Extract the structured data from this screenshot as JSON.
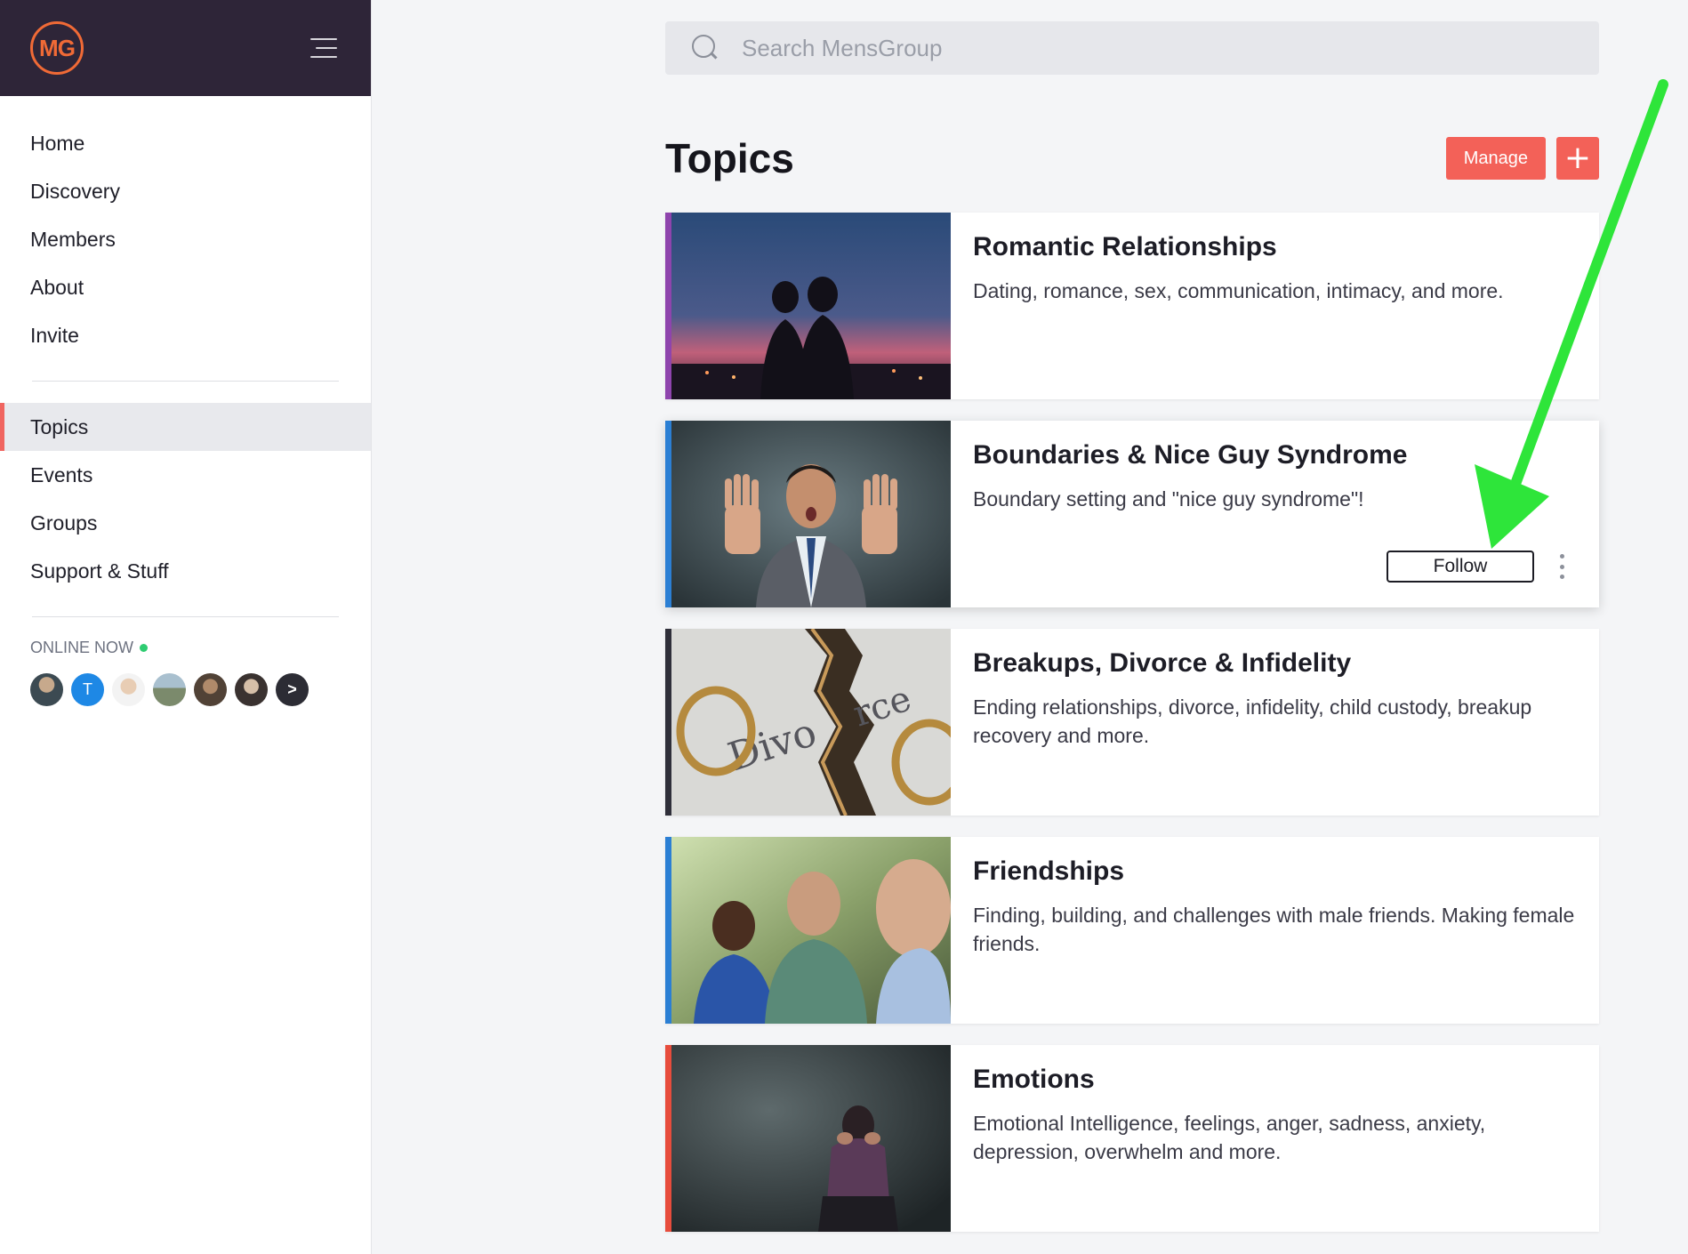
{
  "app": {
    "logo_text": "MG"
  },
  "sidebar": {
    "primary_items": [
      {
        "label": "Home"
      },
      {
        "label": "Discovery"
      },
      {
        "label": "Members"
      },
      {
        "label": "About"
      },
      {
        "label": "Invite"
      }
    ],
    "secondary_items": [
      {
        "label": "Topics",
        "active": true
      },
      {
        "label": "Events"
      },
      {
        "label": "Groups"
      },
      {
        "label": "Support & Stuff"
      }
    ],
    "online_label": "ONLINE NOW",
    "online_status_color": "#2ecc71",
    "avatars": [
      {
        "initial": "",
        "color": "#5a6b74"
      },
      {
        "initial": "T",
        "color": "#1e88e5"
      },
      {
        "initial": "",
        "color": "#c9b8a6"
      },
      {
        "initial": "",
        "color": "#7b8a7c"
      },
      {
        "initial": "",
        "color": "#6b5a4c"
      },
      {
        "initial": "",
        "color": "#4a4240"
      },
      {
        "initial": ">",
        "color": "#2c2c34"
      }
    ]
  },
  "search": {
    "placeholder": "Search MensGroup"
  },
  "topics": {
    "title": "Topics",
    "manage_label": "Manage",
    "add_label": "+",
    "accent_color": "#f36158",
    "items": [
      {
        "title": "Romantic Relationships",
        "description": "Dating, romance, sex, communication, intimacy, and more.",
        "accent": "#8e44ad"
      },
      {
        "title": "Boundaries & Nice Guy Syndrome",
        "description": "Boundary setting and \"nice guy syndrome\"!",
        "accent": "#2b7fd4",
        "follow_label": "Follow"
      },
      {
        "title": "Breakups, Divorce & Infidelity",
        "description": "Ending relationships, divorce, infidelity, child custody, breakup recovery and more.",
        "accent": "#2f2f3a"
      },
      {
        "title": "Friendships",
        "description": "Finding, building, and challenges with male friends. Making female friends.",
        "accent": "#2b7fd4"
      },
      {
        "title": "Emotions",
        "description": "Emotional Intelligence, feelings, anger, sadness, anxiety, depression, overwhelm and more.",
        "accent": "#e74c3c"
      }
    ]
  },
  "annotation": {
    "arrow_color": "#2ee53a"
  }
}
